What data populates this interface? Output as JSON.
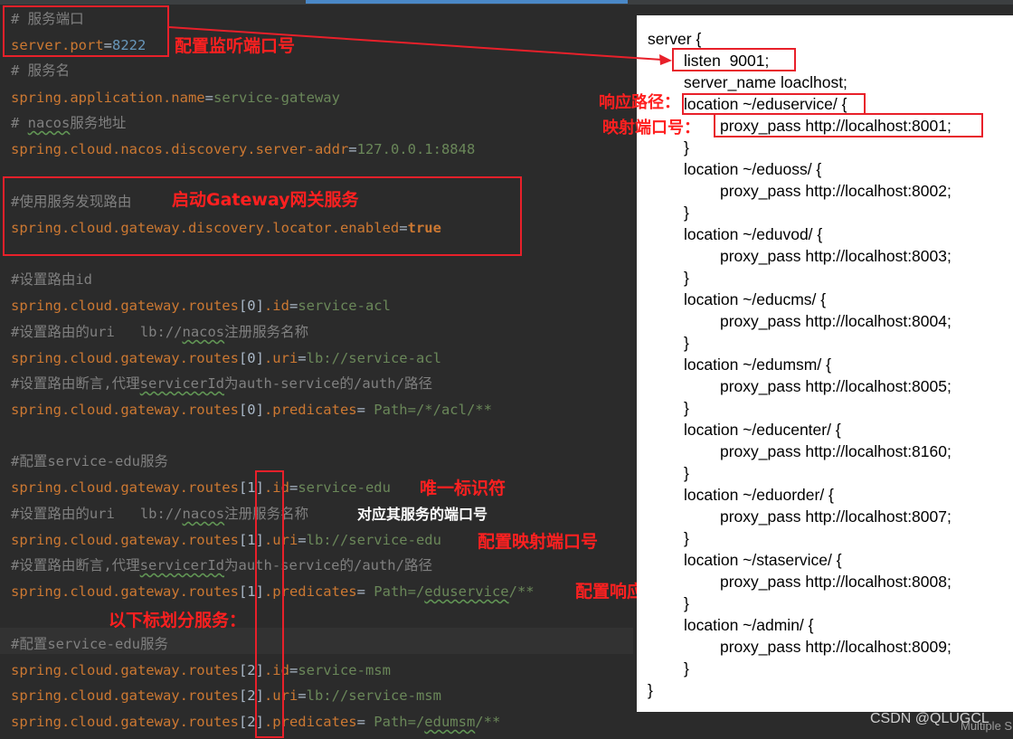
{
  "code_lines": [
    {
      "comment": "# 服务端口"
    },
    {
      "key": "server.port",
      "eq": "=",
      "num": "8222"
    },
    {
      "comment": "# 服务名"
    },
    {
      "key": "spring.application.name",
      "eq": "=",
      "val": "service-gateway"
    },
    {
      "comment_pre": "# ",
      "comment_wavy": "nacos",
      "comment_post": "服务地址"
    },
    {
      "key": "spring.cloud.nacos.discovery.server-addr",
      "eq": "=",
      "val": "127.0.0.1:8848"
    },
    {
      "comment": "#使用服务发现路由"
    },
    {
      "key": "spring.cloud.gateway.discovery.locator.enabled",
      "eq": "=",
      "kw": "true"
    },
    {
      "comment": "#设置路由id"
    },
    {
      "key": "spring.cloud.gateway.routes",
      "idx": "[0]",
      "prop": ".id",
      "eq": "=",
      "val": "service-acl"
    },
    {
      "comment_pre": "#设置路由的uri   lb://",
      "comment_wavy": "nacos",
      "comment_post": "注册服务名称"
    },
    {
      "key": "spring.cloud.gateway.routes",
      "idx": "[0]",
      "prop": ".uri",
      "eq": "=",
      "val": "lb://service-acl"
    },
    {
      "comment_pre": "#设置路由断言,代理",
      "comment_wavy": "servicerId",
      "comment_post": "为auth-service的/auth/路径"
    },
    {
      "key": "spring.cloud.gateway.routes",
      "idx": "[0]",
      "prop": ".predicates",
      "eq": "=",
      "val": " Path=/*/acl/**"
    },
    {
      "comment": "#配置service-edu服务"
    },
    {
      "key": "spring.cloud.gateway.routes",
      "idx": "[1]",
      "prop": ".id",
      "eq": "=",
      "val": "service-edu"
    },
    {
      "comment_pre": "#设置路由的uri   lb://",
      "comment_wavy": "nacos",
      "comment_post": "注册服务名称"
    },
    {
      "key": "spring.cloud.gateway.routes",
      "idx": "[1]",
      "prop": ".uri",
      "eq": "=",
      "val": "lb://service-edu"
    },
    {
      "comment_pre": "#设置路由断言,代理",
      "comment_wavy": "servicerId",
      "comment_post": "为auth-service的/auth/路径"
    },
    {
      "key": "spring.cloud.gateway.routes",
      "idx": "[1]",
      "prop": ".predicates",
      "eq": "=",
      "val_pre": " Path=/",
      "val_wavy": "eduservice",
      "val_post": "/**"
    },
    {
      "comment": "#配置service-edu服务"
    },
    {
      "key": "spring.cloud.gateway.routes",
      "idx": "[2]",
      "prop": ".id",
      "eq": "=",
      "val": "service-msm"
    },
    {
      "key": "spring.cloud.gateway.routes",
      "idx": "[2]",
      "prop": ".uri",
      "eq": "=",
      "val": "lb://service-msm"
    },
    {
      "key": "spring.cloud.gateway.routes",
      "idx": "[2]",
      "prop": ".predicates",
      "eq": "=",
      "val_pre": " Path=/",
      "val_wavy": "edumsm",
      "val_post": "/**"
    }
  ],
  "annotations": {
    "port": "配置监听端口号",
    "gateway": "启动Gateway网关服务",
    "unique_id": "唯一标识符",
    "service_port": "对应其服务的端口号",
    "map_port": "配置映射端口号",
    "resp_path": "配置响应路径",
    "divide": "以下标划分服务：",
    "nginx_path": "响应路径：",
    "nginx_port": "映射端口号："
  },
  "nginx": [
    "server {",
    "listen  9001;",
    "server_name loaclhost;",
    "location ~/eduservice/ {",
    "proxy_pass http://localhost:8001;",
    "}",
    "location ~/eduoss/ {",
    "proxy_pass http://localhost:8002;",
    "}",
    "location ~/eduvod/ {",
    "proxy_pass http://localhost:8003;",
    "}",
    "location ~/educms/ {",
    "proxy_pass http://localhost:8004;",
    "}",
    "location ~/edumsm/ {",
    "proxy_pass http://localhost:8005;",
    "}",
    "location ~/educenter/ {",
    "proxy_pass http://localhost:8160;",
    "}",
    "location ~/eduorder/ {",
    "proxy_pass http://localhost:8007;",
    "}",
    "location ~/staservice/ {",
    "proxy_pass http://localhost:8008;",
    "}",
    "location ~/admin/ {",
    "proxy_pass http://localhost:8009;",
    "}",
    "}"
  ],
  "watermark": "CSDN @QLUGCL",
  "status_fragment": "Multiple S",
  "colors": {
    "annotation_red": "#ff2020",
    "comment": "#808080",
    "keyword": "#cc7832",
    "string": "#6a8759",
    "number": "#6897bb"
  }
}
